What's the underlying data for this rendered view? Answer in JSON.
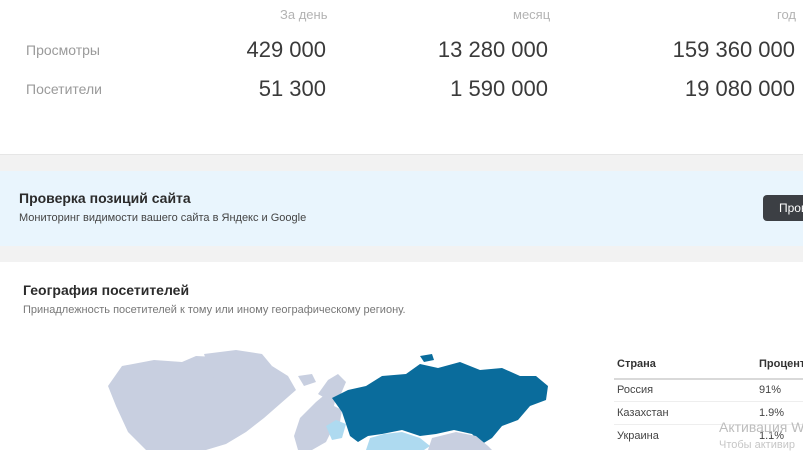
{
  "stats": {
    "headers": {
      "day": "За день",
      "month": "месяц",
      "year": "год"
    },
    "rows": [
      {
        "label": "Просмотры",
        "day": "429 000",
        "month": "13 280 000",
        "year": "159 360 000"
      },
      {
        "label": "Посетители",
        "day": "51 300",
        "month": "1 590 000",
        "year": "19 080 000"
      }
    ]
  },
  "banner": {
    "title": "Проверка позиций сайта",
    "subtitle": "Мониторинг видимости вашего сайта в Яндекс и Google",
    "button_label": "Пров"
  },
  "geo": {
    "title": "География посетителей",
    "subtitle": "Принадлежность посетителей к тому или иному географическому региону.",
    "table": {
      "headers": {
        "country": "Страна",
        "percent": "Процент"
      },
      "rows": [
        {
          "country": "Россия",
          "percent": "91%"
        },
        {
          "country": "Казахстан",
          "percent": "1.9%"
        },
        {
          "country": "Украина",
          "percent": "1.1%"
        }
      ]
    },
    "colors": {
      "primary": "#0a6c9c",
      "secondary": "#aedaf0",
      "land": "#c8cfe0"
    }
  },
  "watermark": {
    "line1": "Активация W",
    "line2": "Чтобы активир"
  }
}
